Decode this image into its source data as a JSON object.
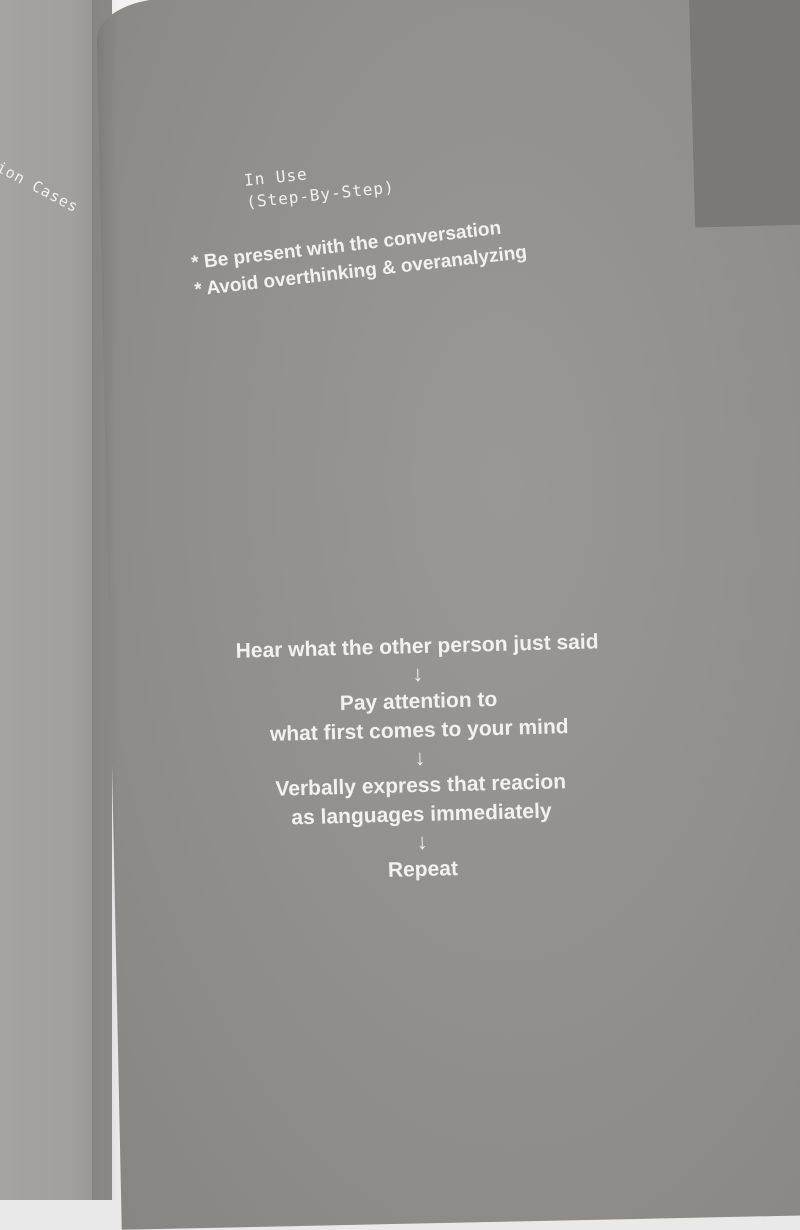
{
  "left_page": {
    "section_label": "ion Cases"
  },
  "right_page": {
    "heading": {
      "line1": "In Use",
      "line2": "(Step-By-Step)"
    },
    "bullets": [
      "* Be present with the conversation",
      "* Avoid overthinking & overanalyzing"
    ],
    "flow": {
      "step1": "Hear what the other person just said",
      "step2_line1": "Pay attention to",
      "step2_line2": "what first comes to your mind",
      "step3_line1": "Verbally express that reacion",
      "step3_line2": "as languages immediately",
      "step4": "Repeat",
      "arrow": "↓"
    }
  },
  "colors": {
    "page": "#918f8b",
    "left_page": "#a19f9b",
    "dark_block": "#7b7976",
    "text": "#f1f1ef"
  }
}
